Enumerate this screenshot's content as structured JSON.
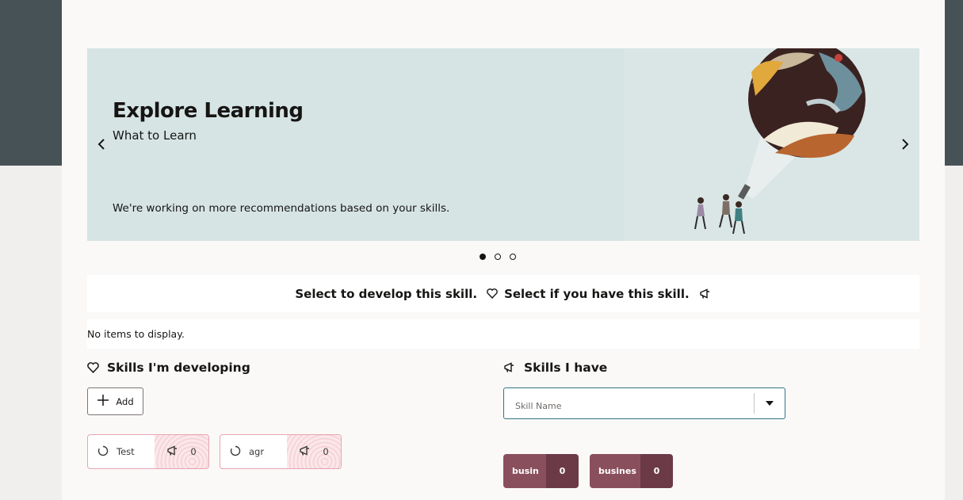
{
  "hero": {
    "title": "Explore Learning",
    "subtitle": "What to Learn",
    "message": "We're working on more recommendations based on your skills.",
    "prev_icon": "chevron-left-icon",
    "next_icon": "chevron-right-icon",
    "slides_total": 3,
    "active_slide": 1
  },
  "legend": {
    "develop_text": "Select to develop this skill.",
    "develop_icon": "heart-icon",
    "have_text": "Select if you have this skill.",
    "have_icon": "megaphone-icon"
  },
  "recommendations": {
    "empty_text": "No items to display."
  },
  "developing": {
    "title": "Skills I'm developing",
    "icon": "heart-icon",
    "add_label": "Add",
    "add_icon": "plus-icon",
    "skills": [
      {
        "name": "Test",
        "count": "0",
        "status_icon": "progress-circle-icon",
        "endorse_icon": "megaphone-icon"
      },
      {
        "name": "agr",
        "count": "0",
        "status_icon": "progress-circle-icon",
        "endorse_icon": "megaphone-icon"
      }
    ]
  },
  "have": {
    "title": "Skills I have",
    "icon": "megaphone-icon",
    "search": {
      "placeholder": "Skill Name",
      "value": ""
    },
    "dropdown_icon": "caret-down-icon",
    "skills": [
      {
        "name": "busin",
        "count": "0"
      },
      {
        "name": "busines",
        "count": "0"
      }
    ]
  },
  "colors": {
    "header_bg": "#475257",
    "hero_bg": "#d6e4e4",
    "skill_chip": "#8a4f5d",
    "skill_chip_count": "#6c3a47",
    "focus_border": "#2e7584",
    "dev_card_border": "#e5a5b1"
  }
}
